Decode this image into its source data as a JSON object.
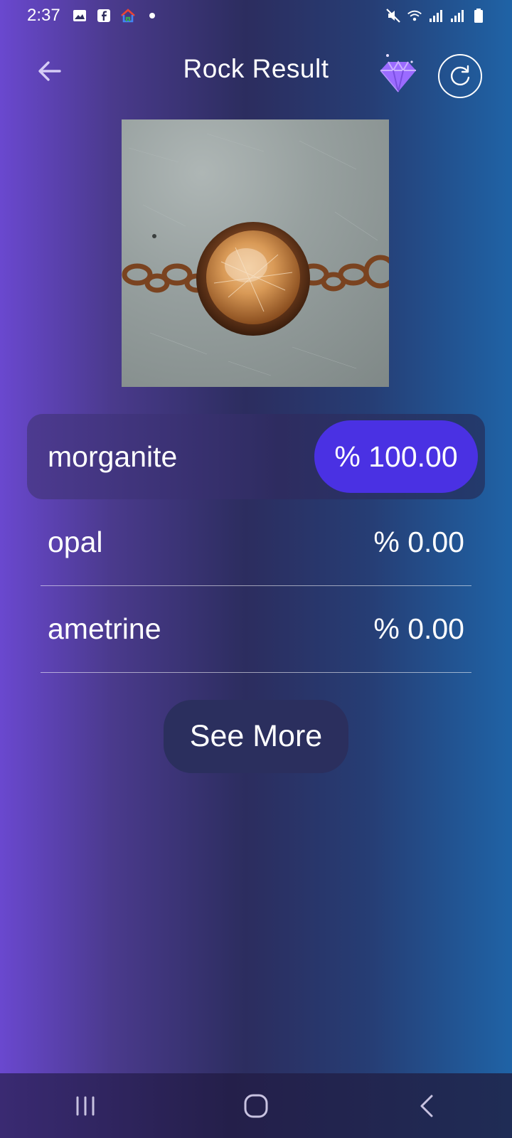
{
  "status_bar": {
    "time": "2:37",
    "left_icons": [
      "gallery-icon",
      "facebook-icon",
      "google-home-icon",
      "dot-icon"
    ],
    "right_icons": [
      "mute-icon",
      "wifi-icon",
      "signal-icon",
      "signal-icon",
      "battery-icon"
    ]
  },
  "header": {
    "title": "Rock Result",
    "gem_color": "#9b6bff"
  },
  "results": {
    "top": {
      "name": "morganite",
      "value": "% 100.00",
      "pill_color": "#4a31e3"
    },
    "rows": [
      {
        "name": "opal",
        "value": "% 0.00"
      },
      {
        "name": "ametrine",
        "value": "% 0.00"
      }
    ]
  },
  "see_more_label": "See More",
  "nav": {
    "buttons": [
      "recents-icon",
      "home-icon",
      "back-icon"
    ]
  }
}
